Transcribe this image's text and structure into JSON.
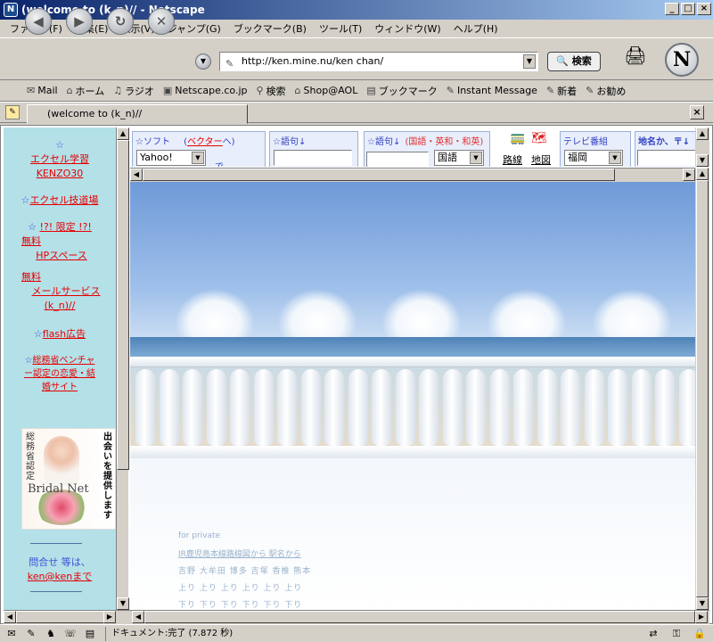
{
  "window": {
    "title": "(welcome to (k_n)// - Netscape",
    "icon": "netscape-icon",
    "controls": [
      "minimize",
      "maximize",
      "close"
    ]
  },
  "menu": [
    "ファイル(F)",
    "編集(E)",
    "表示(V)",
    "ジャンプ(G)",
    "ブックマーク(B)",
    "ツール(T)",
    "ウィンドウ(W)",
    "ヘルプ(H)"
  ],
  "navbar": {
    "back": "◀",
    "forward": "▶",
    "reload": "↻",
    "stop": "✕",
    "url": "http://ken.mine.nu/ken chan/",
    "search_label": "検索"
  },
  "personal_toolbar": [
    {
      "icon": "mail-icon",
      "label": "Mail"
    },
    {
      "icon": "home-icon",
      "label": "ホーム"
    },
    {
      "icon": "radio-icon",
      "label": "ラジオ"
    },
    {
      "icon": "my-icon",
      "label": "Netscape.co.jp"
    },
    {
      "icon": "search-icon",
      "label": "検索"
    },
    {
      "icon": "shop-icon",
      "label": "Shop@AOL"
    },
    {
      "icon": "folder-icon",
      "label": "ブックマーク"
    },
    {
      "icon": "bookmark-icon",
      "label": "Instant Message"
    },
    {
      "icon": "bookmark-icon",
      "label": "新着"
    },
    {
      "icon": "bookmark-icon",
      "label": "お勧め"
    }
  ],
  "tab": {
    "title": "(welcome to (k_n)//"
  },
  "sidebar": {
    "excel_study": "エクセル学習",
    "kenzo": "KENZO30",
    "excel_dojo": "エクセル技道場",
    "limited": "!?! 限定 !?!",
    "free1": "無料",
    "hp_space": "HPスペース",
    "free2": "無料",
    "mail_service": "メールサービス",
    "kn": "(k_n)//",
    "flash_ad": "flash広告",
    "ministry": "総務省ベンチャー認定の恋愛・結婚サイト",
    "ad_vertical": "出会いを提供します",
    "ad_side": "総務省認定",
    "ad_brand": "Bridal Net",
    "contact": "問合せ 等は、",
    "contact_link": "ken@kenまで",
    "star": "☆"
  },
  "top_widgets": {
    "soft_label": "☆ソフト",
    "soft_link": "ベクター",
    "soft_select": "Yahoo!",
    "soft_de": "で",
    "phrase1_label": "☆語句↓",
    "phrase2_label": "☆語句↓",
    "phrase2_extra": "(国語・英和・和英)",
    "phrase2_select": "国語",
    "route_label": "路線",
    "map_label": "地図",
    "tv_label": "テレビ番組",
    "tv_select": "福岡",
    "place_label": "地名か、〒↓"
  },
  "main": {
    "for_private": "for private",
    "jr_link": "JR鹿児島本線路線図から 駅名から",
    "stations": "吉野 大牟田 博多 吉塚 香椎 熊本",
    "up_row": "上り 上り 上り 上り 上り 上り",
    "down_row": "下り 下り 下り 下り 下り 下り"
  },
  "status": {
    "message": "ドキュメント:完了 (7.872 秒)"
  }
}
